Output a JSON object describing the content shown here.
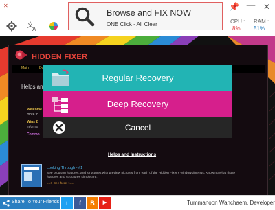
{
  "header": {
    "browse_title": "Browse and FIX NOW",
    "browse_subtitle": "ONE Click - All Clear",
    "cpu_label": "CPU :",
    "cpu_value": "8%",
    "ram_label": "RAM :",
    "ram_value": "51%",
    "icons": [
      "settings-icon",
      "language-icon",
      "color-icon",
      "pin-icon",
      "minimize-icon",
      "close-icon"
    ]
  },
  "app": {
    "brand": "HIDDEN FIXER",
    "menu": [
      "Main",
      "Do"
    ],
    "helps_heading": "Helps and",
    "bullets": [
      "Welcome",
      "more th",
      "Wins 2",
      "Informa",
      "Commo"
    ],
    "helps_instructions": "Helps and Instructions",
    "looking_title": "Looking Through - #1",
    "looking_text": "See program features, and structures with preview pictures from each of the Hidden Fixer's windows/menus. Knowing what those features and structures simply are.",
    "looking_link": "==> See here <=="
  },
  "dialog": {
    "regular": "Regular Recovery",
    "deep": "Deep Recovery",
    "cancel": "Cancel"
  },
  "footer": {
    "share": "Share To Your Friends",
    "developer": "Tummanoon Wanchaem, Developer",
    "social": [
      "twitter-icon",
      "facebook-icon",
      "blogger-icon",
      "youtube-icon"
    ]
  },
  "colors": {
    "regular": "#22b4b4",
    "deep": "#d61f8c",
    "cancel": "#262626",
    "cpu": "#e0393c",
    "ram": "#2a7fc1",
    "share": "#2a7fc1"
  }
}
